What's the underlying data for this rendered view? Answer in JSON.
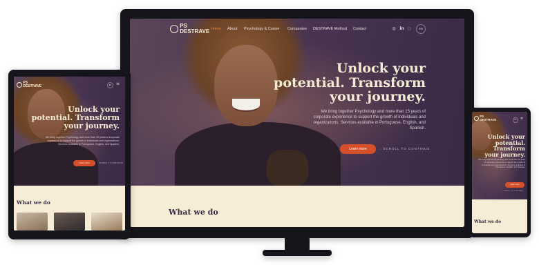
{
  "brand": {
    "line1": "PS",
    "line2": "DESTRAVE"
  },
  "nav": {
    "items": [
      "Home",
      "About",
      "Psychology & Career",
      "Companies",
      "DESTRAVE Method",
      "Contact"
    ],
    "social_icons": [
      "instagram-icon",
      "linkedin-icon",
      "whatsapp-icon"
    ],
    "language": "EN",
    "menu_icon": "hamburger-menu-icon"
  },
  "hero": {
    "heading_line1": "Unlock your",
    "heading_line2": "potential. Transform",
    "heading_line3": "your journey.",
    "paragraph": "We bring together Psychology and more than 15 years of corporate experience to support the growth of individuals and organizations. Services available in Portuguese, English, and Spanish.",
    "cta_label": "Learn more",
    "scroll_label": "↓ SCROLL TO CONTINUE"
  },
  "sections": {
    "what_we_do": "What we do"
  },
  "colors": {
    "accent": "#d5502a",
    "hero_bg": "#4a3552",
    "cream": "#f7edd6",
    "heading_text": "#f6ecd6",
    "nav_active": "#e8863a"
  }
}
